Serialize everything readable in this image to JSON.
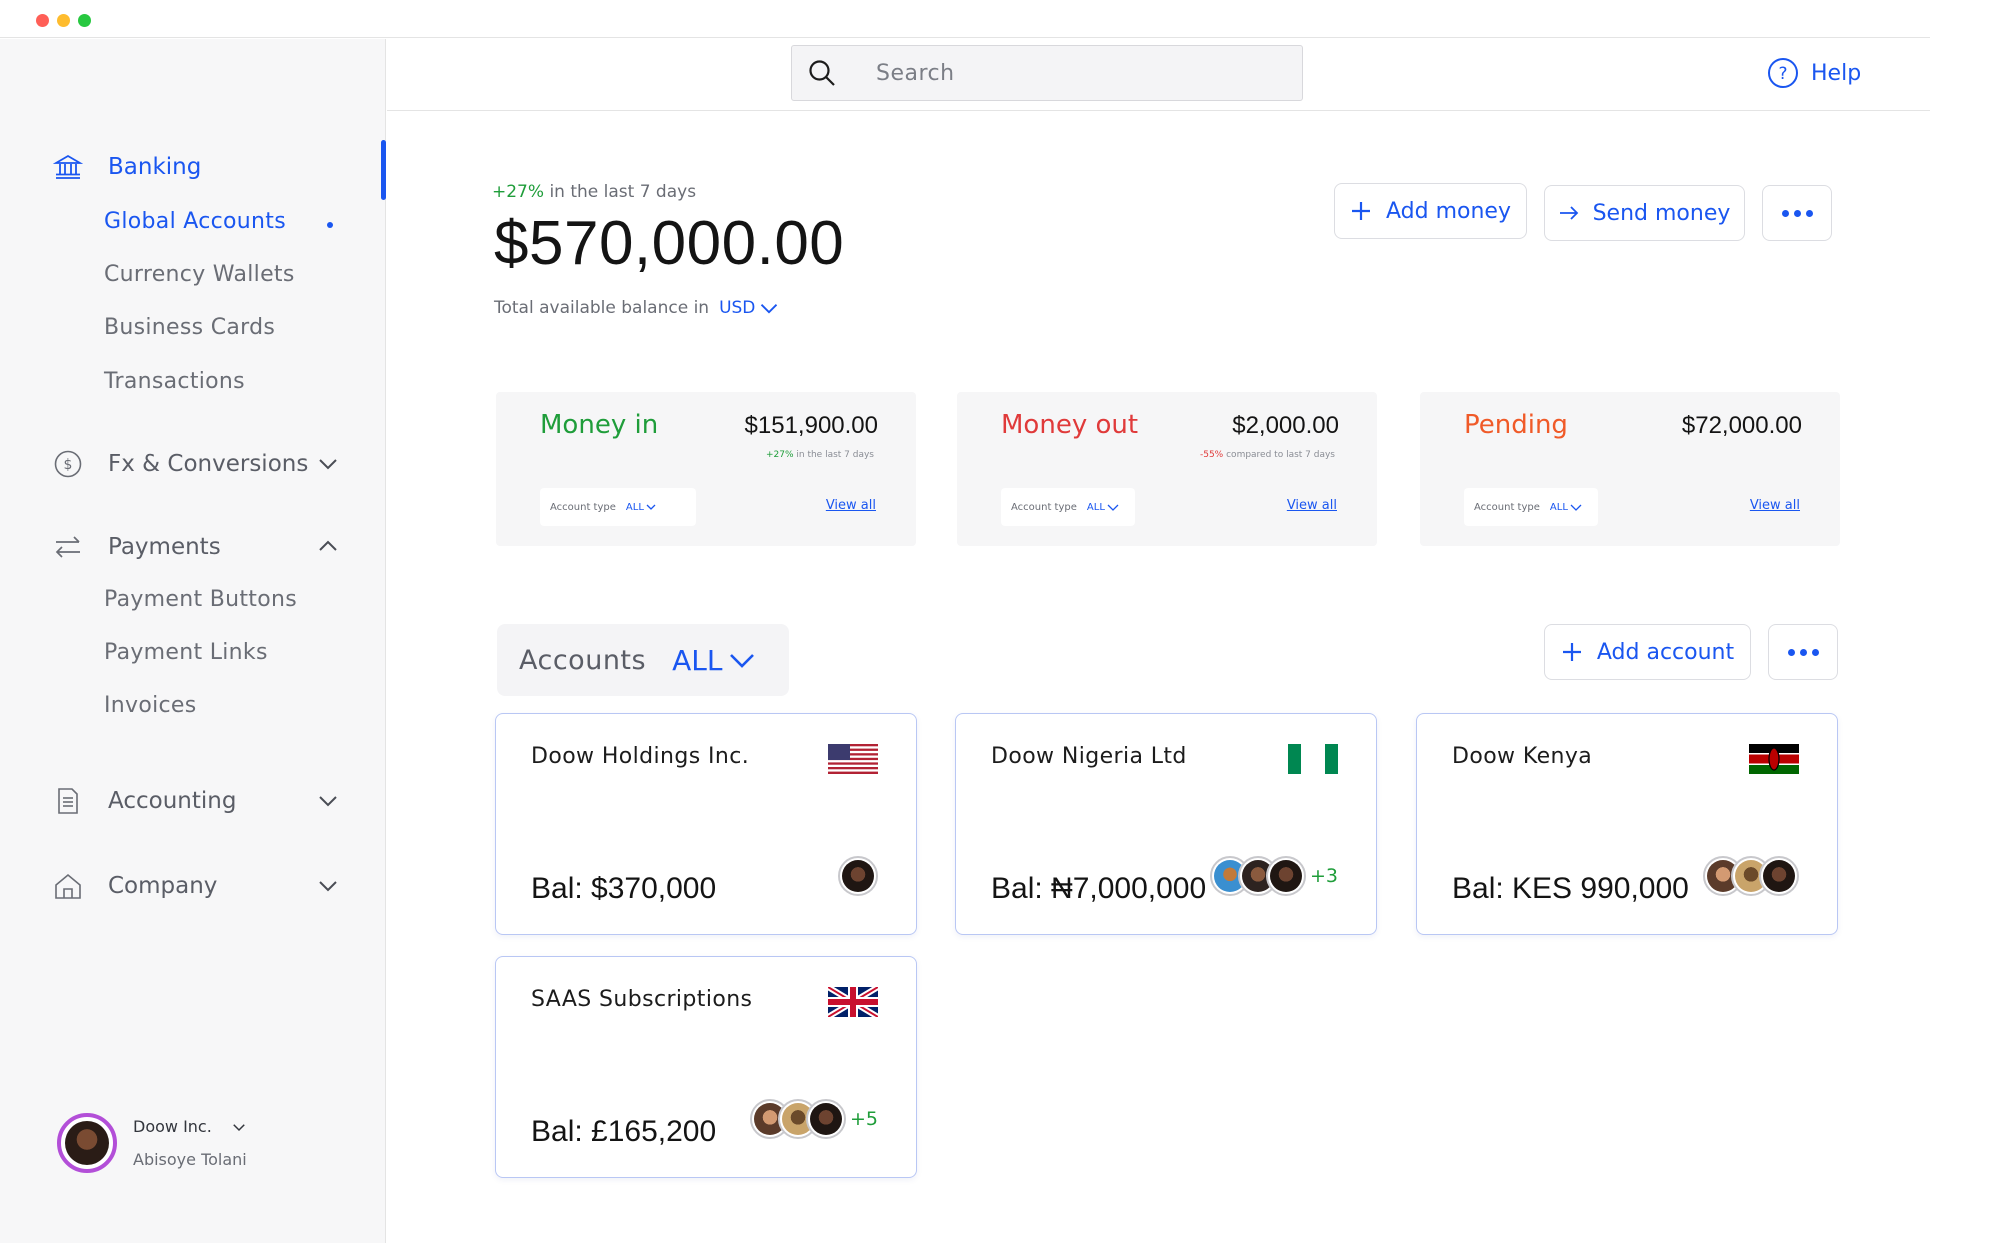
{
  "colors": {
    "accent": "#1a56f0",
    "positive": "#1f9d3a",
    "negative": "#e03a3a",
    "pending": "#f05a28",
    "profile_ring": "#b34fd8"
  },
  "sidebar": {
    "banking": {
      "label": "Banking",
      "icon": "bank-icon"
    },
    "banking_items": [
      {
        "label": "Global Accounts",
        "active": true
      },
      {
        "label": "Currency Wallets"
      },
      {
        "label": "Business Cards"
      },
      {
        "label": "Transactions"
      }
    ],
    "fx": {
      "label": "Fx & Conversions",
      "icon": "dollar-circle-icon"
    },
    "payments": {
      "label": "Payments",
      "icon": "transfer-arrows-icon"
    },
    "payments_items": [
      {
        "label": "Payment Buttons"
      },
      {
        "label": "Payment Links"
      },
      {
        "label": "Invoices"
      }
    ],
    "accounting": {
      "label": "Accounting",
      "icon": "document-icon"
    },
    "company": {
      "label": "Company",
      "icon": "home-icon"
    },
    "profile": {
      "org": "Doow Inc.",
      "user": "Abisoye Tolani"
    }
  },
  "header": {
    "search_placeholder": "Search",
    "help_label": "Help"
  },
  "balance": {
    "trend_pct": "+27%",
    "trend_text": "in the last 7 days",
    "amount": "$570,000.00",
    "caption": "Total available balance in",
    "currency": "USD"
  },
  "actions": {
    "add_money": "Add money",
    "send_money": "Send money"
  },
  "summary_cards": [
    {
      "label": "Money in",
      "value": "$151,900.00",
      "note_pct": "+27%",
      "note_text": "in the last 7 days",
      "account_type_label": "Account type",
      "account_type_value": "ALL",
      "view_all": "View all"
    },
    {
      "label": "Money out",
      "value": "$2,000.00",
      "note_pct": "-55%",
      "note_text": "compared to last 7 days",
      "account_type_label": "Account type",
      "account_type_value": "ALL",
      "view_all": "View all"
    },
    {
      "label": "Pending",
      "value": "$72,000.00",
      "note_pct": "",
      "note_text": "",
      "account_type_label": "Account type",
      "account_type_value": "ALL",
      "view_all": "View all"
    }
  ],
  "accounts": {
    "label": "Accounts",
    "filter_value": "ALL",
    "add_account": "Add account",
    "items": [
      {
        "name": "Doow Holdings Inc.",
        "balance": "Bal: $370,000",
        "flag": "us-flag-icon",
        "more": ""
      },
      {
        "name": "Doow Nigeria Ltd",
        "balance": "Bal: ₦7,000,000",
        "flag": "nigeria-flag-icon",
        "more": "+3"
      },
      {
        "name": "Doow Kenya",
        "balance": "Bal: KES 990,000",
        "flag": "kenya-flag-icon",
        "more": ""
      },
      {
        "name": "SAAS Subscriptions",
        "balance": "Bal: £165,200",
        "flag": "uk-flag-icon",
        "more": "+5"
      }
    ]
  }
}
